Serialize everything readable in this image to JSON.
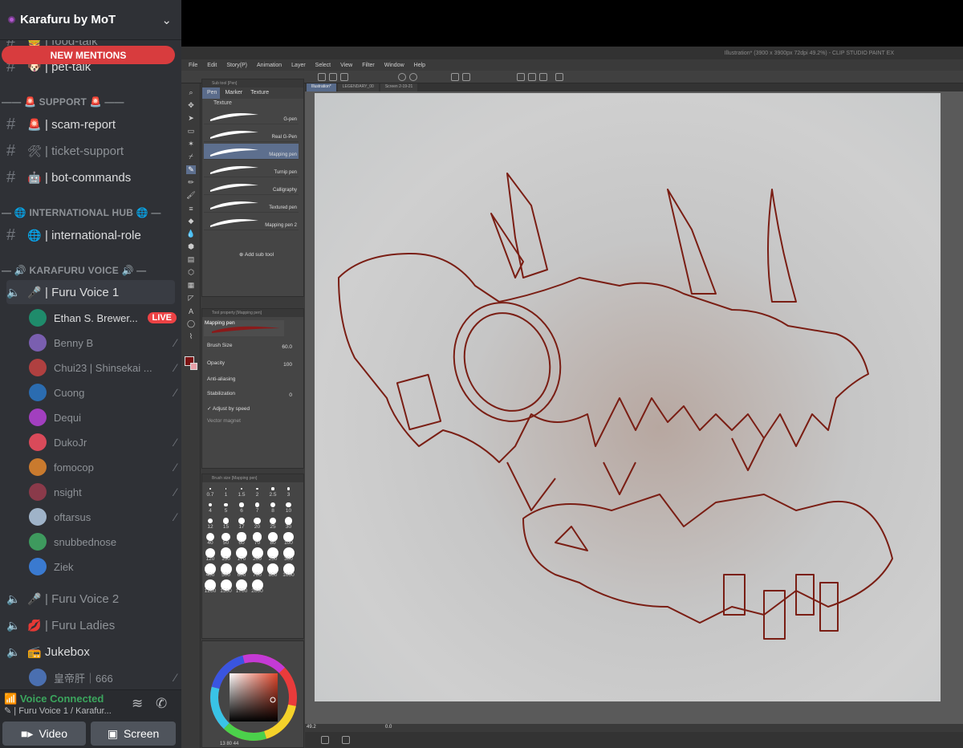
{
  "server": {
    "name": "Karafuru by MoT"
  },
  "new_mentions": "NEW MENTIONS",
  "channels_top": [
    {
      "emoji": "🍔",
      "label": "| food-talk"
    },
    {
      "emoji": "🐶",
      "label": "| pet-talk"
    }
  ],
  "categories": {
    "support": "SUPPORT",
    "international": "INTERNATIONAL HUB",
    "voice": "KARAFURU VOICE"
  },
  "support_channels": [
    {
      "emoji": "🚨",
      "label": "| scam-report"
    },
    {
      "emoji": "🛠",
      "label": "| ticket-support"
    },
    {
      "emoji": "🤖",
      "label": "| bot-commands"
    }
  ],
  "international_channels": [
    {
      "emoji": "🌐",
      "label": "| international-role"
    }
  ],
  "voice_channels": [
    {
      "emoji": "🎤",
      "label": "| Furu Voice 1"
    },
    {
      "emoji": "🎤",
      "label": "| Furu Voice 2"
    },
    {
      "emoji": "💋",
      "label": "| Furu Ladies"
    },
    {
      "emoji": "📻",
      "label": "Jukebox"
    },
    {
      "emoji": "",
      "label": "皇帝肝｜666"
    }
  ],
  "voice_users": [
    {
      "name": "Ethan S. Brewer...",
      "live": "LIVE",
      "color": "#1f8b6b"
    },
    {
      "name": "Benny B",
      "color": "#7a5fb0"
    },
    {
      "name": "Chui23 | Shinsekai ...",
      "color": "#b04040"
    },
    {
      "name": "Cuong",
      "color": "#2b6cb0"
    },
    {
      "name": "Dequi",
      "color": "#a23fbf"
    },
    {
      "name": "DukoJr",
      "color": "#d94a5a"
    },
    {
      "name": "fomocop",
      "color": "#c97a2e"
    },
    {
      "name": "nsight",
      "color": "#8a3a4a"
    },
    {
      "name": "oftarsus",
      "color": "#9fb3c8"
    },
    {
      "name": "snubbednose",
      "color": "#3e9a5e"
    },
    {
      "name": "Ziek",
      "color": "#3a7ad0"
    }
  ],
  "voice_status": {
    "title": "Voice Connected",
    "sub": "Furu Voice 1 / Karafur..."
  },
  "buttons": {
    "video": "Video",
    "screen": "Screen"
  },
  "csp": {
    "title": "Illustration* (3900 x 3900px 72dpi 49.2%) - CLIP STUDIO PAINT EX",
    "menu": [
      "File",
      "Edit",
      "Story(P)",
      "Animation",
      "Layer",
      "Select",
      "View",
      "Filter",
      "Window",
      "Help"
    ],
    "subtool_header": "Sub tool [Pen]",
    "subtool_tabs": [
      "Pen",
      "Marker",
      "Texture"
    ],
    "texture_label": "Texture",
    "brushes": [
      "G-pen",
      "Real G-Pen",
      "Mapping pen",
      "Turnip pen",
      "Calligraphy",
      "Textured pen",
      "Mapping pen 2"
    ],
    "add_sub_tool": "Add sub tool",
    "tool_property_header": "Tool property [Mapping pen]",
    "current_brush": "Mapping pen",
    "props": {
      "brush_size": "Brush Size",
      "brush_size_val": "60.0",
      "opacity": "Opacity",
      "opacity_val": "100",
      "anti_aliasing": "Anti-aliasing",
      "stabilization": "Stabilization",
      "stabilization_val": "0",
      "adjust": "Adjust by speed",
      "vector_magnet": "Vector magnet"
    },
    "brush_size_header": "Brush size [Mapping pen]",
    "brush_sizes": [
      "0.7",
      "1",
      "1.5",
      "2",
      "2.5",
      "3",
      "4",
      "5",
      "6",
      "7",
      "8",
      "10",
      "12",
      "15",
      "17",
      "20",
      "25",
      "30",
      "40",
      "50",
      "60",
      "70",
      "80",
      "100",
      "120",
      "150",
      "170",
      "200",
      "250",
      "300",
      "400",
      "500",
      "600",
      "700",
      "800",
      "1000",
      "1200",
      "1500",
      "1700",
      "2000"
    ],
    "file_tabs": [
      "Illustration*",
      "LEGENDARY_00",
      "Screen 2-19-21"
    ],
    "zoom": "49.2",
    "rotation": "0.0",
    "color_info": "13  80  44"
  }
}
